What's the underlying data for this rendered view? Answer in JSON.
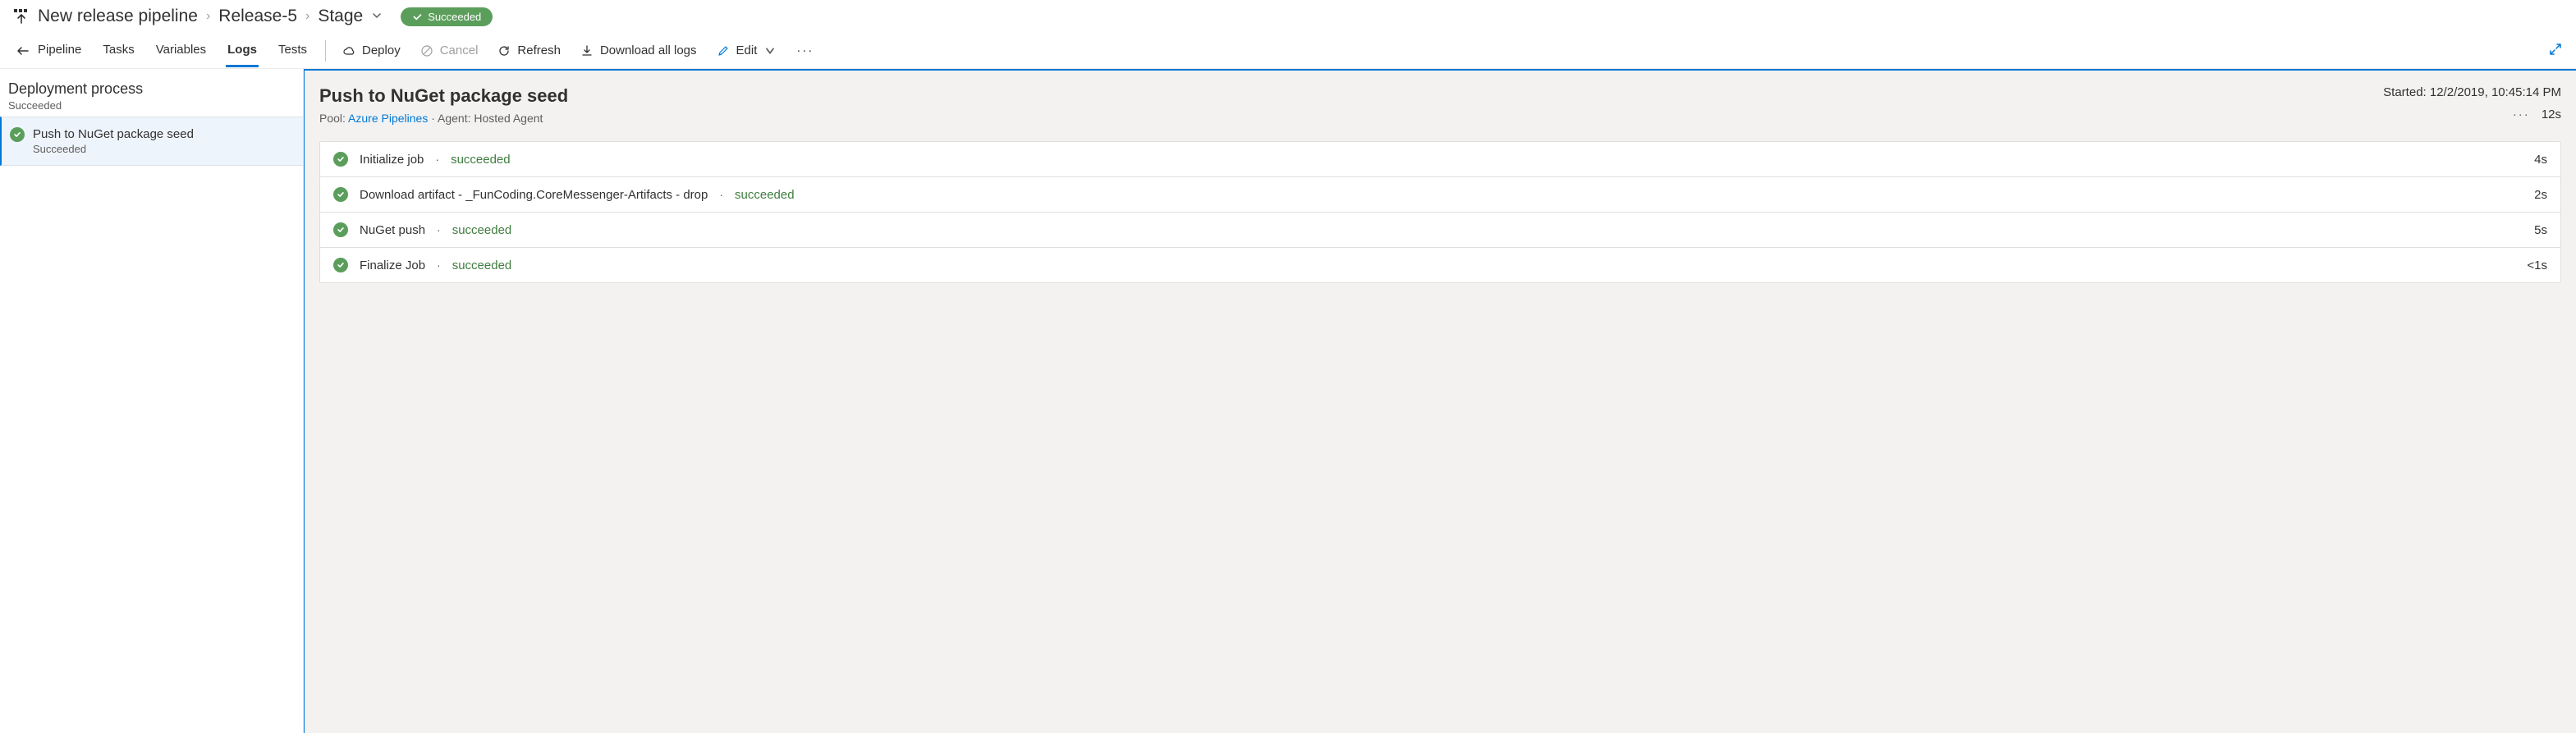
{
  "breadcrumb": {
    "pipeline": "New release pipeline",
    "release": "Release-5",
    "stage": "Stage"
  },
  "status_badge": "Succeeded",
  "tabs": {
    "pipeline": "Pipeline",
    "tasks": "Tasks",
    "variables": "Variables",
    "logs": "Logs",
    "tests": "Tests"
  },
  "actions": {
    "deploy": "Deploy",
    "cancel": "Cancel",
    "refresh": "Refresh",
    "download": "Download all logs",
    "edit": "Edit"
  },
  "sidebar": {
    "process_title": "Deployment process",
    "process_status": "Succeeded",
    "item": {
      "name": "Push to NuGet package seed",
      "status": "Succeeded"
    }
  },
  "main": {
    "title": "Push to NuGet package seed",
    "pool_label": "Pool:",
    "pool_name": "Azure Pipelines",
    "agent_label": "Agent: Hosted Agent",
    "started_label": "Started:",
    "started_value": "12/2/2019, 10:45:14 PM",
    "total_duration": "12s",
    "steps": [
      {
        "name": "Initialize job",
        "status": "succeeded",
        "duration": "4s"
      },
      {
        "name": "Download artifact - _FunCoding.CoreMessenger-Artifacts - drop",
        "status": "succeeded",
        "duration": "2s"
      },
      {
        "name": "NuGet push",
        "status": "succeeded",
        "duration": "5s"
      },
      {
        "name": "Finalize Job",
        "status": "succeeded",
        "duration": "<1s"
      }
    ]
  }
}
